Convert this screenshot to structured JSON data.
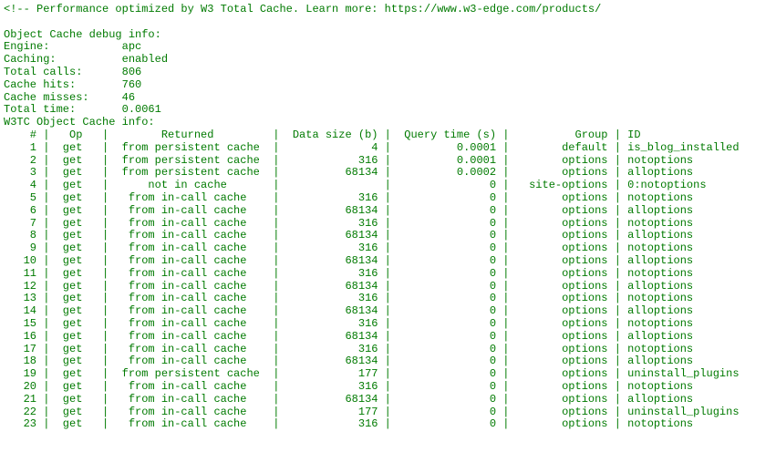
{
  "header_comment": "<!-- Performance optimized by W3 Total Cache. Learn more: https://www.w3-edge.com/products/",
  "debug_title": "Object Cache debug info:",
  "debug_rows": [
    {
      "label": "Engine:",
      "value": "apc"
    },
    {
      "label": "Caching:",
      "value": "enabled"
    },
    {
      "label": "Total calls:",
      "value": "806"
    },
    {
      "label": "Cache hits:",
      "value": "760"
    },
    {
      "label": "Cache misses:",
      "value": "46"
    },
    {
      "label": "Total time:",
      "value": "0.0061"
    }
  ],
  "cache_info_title": "W3TC Object Cache info:",
  "columns": {
    "num": "#",
    "op": "Op",
    "ret": "Returned",
    "size": "Data size (b)",
    "time": "Query time (s)",
    "group": "Group",
    "id": "ID"
  },
  "rows": [
    {
      "num": "1",
      "op": "get",
      "ret": "from persistent cache",
      "size": "4",
      "time": "0.0001",
      "group": "default",
      "id": "is_blog_installed"
    },
    {
      "num": "2",
      "op": "get",
      "ret": "from persistent cache",
      "size": "316",
      "time": "0.0001",
      "group": "options",
      "id": "notoptions"
    },
    {
      "num": "3",
      "op": "get",
      "ret": "from persistent cache",
      "size": "68134",
      "time": "0.0002",
      "group": "options",
      "id": "alloptions"
    },
    {
      "num": "4",
      "op": "get",
      "ret": "not in cache",
      "size": "",
      "time": "0",
      "group": "site-options",
      "id": "0:notoptions"
    },
    {
      "num": "5",
      "op": "get",
      "ret": "from in-call cache",
      "size": "316",
      "time": "0",
      "group": "options",
      "id": "notoptions"
    },
    {
      "num": "6",
      "op": "get",
      "ret": "from in-call cache",
      "size": "68134",
      "time": "0",
      "group": "options",
      "id": "alloptions"
    },
    {
      "num": "7",
      "op": "get",
      "ret": "from in-call cache",
      "size": "316",
      "time": "0",
      "group": "options",
      "id": "notoptions"
    },
    {
      "num": "8",
      "op": "get",
      "ret": "from in-call cache",
      "size": "68134",
      "time": "0",
      "group": "options",
      "id": "alloptions"
    },
    {
      "num": "9",
      "op": "get",
      "ret": "from in-call cache",
      "size": "316",
      "time": "0",
      "group": "options",
      "id": "notoptions"
    },
    {
      "num": "10",
      "op": "get",
      "ret": "from in-call cache",
      "size": "68134",
      "time": "0",
      "group": "options",
      "id": "alloptions"
    },
    {
      "num": "11",
      "op": "get",
      "ret": "from in-call cache",
      "size": "316",
      "time": "0",
      "group": "options",
      "id": "notoptions"
    },
    {
      "num": "12",
      "op": "get",
      "ret": "from in-call cache",
      "size": "68134",
      "time": "0",
      "group": "options",
      "id": "alloptions"
    },
    {
      "num": "13",
      "op": "get",
      "ret": "from in-call cache",
      "size": "316",
      "time": "0",
      "group": "options",
      "id": "notoptions"
    },
    {
      "num": "14",
      "op": "get",
      "ret": "from in-call cache",
      "size": "68134",
      "time": "0",
      "group": "options",
      "id": "alloptions"
    },
    {
      "num": "15",
      "op": "get",
      "ret": "from in-call cache",
      "size": "316",
      "time": "0",
      "group": "options",
      "id": "notoptions"
    },
    {
      "num": "16",
      "op": "get",
      "ret": "from in-call cache",
      "size": "68134",
      "time": "0",
      "group": "options",
      "id": "alloptions"
    },
    {
      "num": "17",
      "op": "get",
      "ret": "from in-call cache",
      "size": "316",
      "time": "0",
      "group": "options",
      "id": "notoptions"
    },
    {
      "num": "18",
      "op": "get",
      "ret": "from in-call cache",
      "size": "68134",
      "time": "0",
      "group": "options",
      "id": "alloptions"
    },
    {
      "num": "19",
      "op": "get",
      "ret": "from persistent cache",
      "size": "177",
      "time": "0",
      "group": "options",
      "id": "uninstall_plugins"
    },
    {
      "num": "20",
      "op": "get",
      "ret": "from in-call cache",
      "size": "316",
      "time": "0",
      "group": "options",
      "id": "notoptions"
    },
    {
      "num": "21",
      "op": "get",
      "ret": "from in-call cache",
      "size": "68134",
      "time": "0",
      "group": "options",
      "id": "alloptions"
    },
    {
      "num": "22",
      "op": "get",
      "ret": "from in-call cache",
      "size": "177",
      "time": "0",
      "group": "options",
      "id": "uninstall_plugins"
    },
    {
      "num": "23",
      "op": "get",
      "ret": "from in-call cache",
      "size": "316",
      "time": "0",
      "group": "options",
      "id": "notoptions"
    }
  ]
}
